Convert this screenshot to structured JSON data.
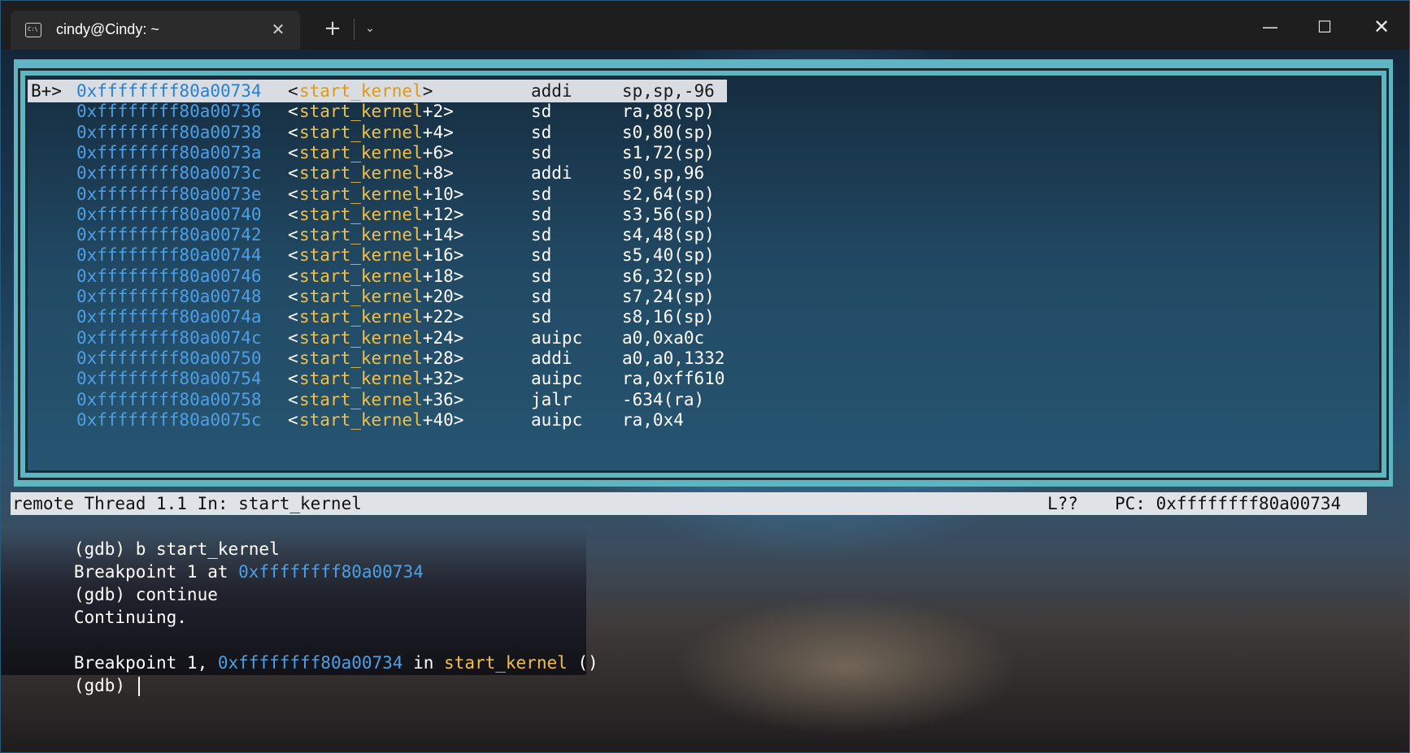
{
  "tab": {
    "title": "cindy@Cindy: ~",
    "icon_glyph": "C:\\",
    "close_glyph": "✕",
    "new_tab_glyph": "+",
    "dropdown_glyph": "⌄"
  },
  "window_controls": {
    "minimize": "—",
    "maximize": "☐",
    "close": "✕"
  },
  "colors": {
    "address": "#4f9fe6",
    "symbol": "#f0c04a",
    "tui_border": "#5fb6c2",
    "status_bg": "#dfe3e8"
  },
  "disassembly": [
    {
      "marker": "B+>",
      "addr": "0xffffffff80a00734",
      "sym": "start_kernel",
      "off": ">",
      "op": "addi",
      "args": "sp,sp,-96",
      "current": true
    },
    {
      "marker": "",
      "addr": "0xffffffff80a00736",
      "sym": "start_kernel",
      "off": "+2>",
      "op": "sd",
      "args": "ra,88(sp)"
    },
    {
      "marker": "",
      "addr": "0xffffffff80a00738",
      "sym": "start_kernel",
      "off": "+4>",
      "op": "sd",
      "args": "s0,80(sp)"
    },
    {
      "marker": "",
      "addr": "0xffffffff80a0073a",
      "sym": "start_kernel",
      "off": "+6>",
      "op": "sd",
      "args": "s1,72(sp)"
    },
    {
      "marker": "",
      "addr": "0xffffffff80a0073c",
      "sym": "start_kernel",
      "off": "+8>",
      "op": "addi",
      "args": "s0,sp,96"
    },
    {
      "marker": "",
      "addr": "0xffffffff80a0073e",
      "sym": "start_kernel",
      "off": "+10>",
      "op": "sd",
      "args": "s2,64(sp)"
    },
    {
      "marker": "",
      "addr": "0xffffffff80a00740",
      "sym": "start_kernel",
      "off": "+12>",
      "op": "sd",
      "args": "s3,56(sp)"
    },
    {
      "marker": "",
      "addr": "0xffffffff80a00742",
      "sym": "start_kernel",
      "off": "+14>",
      "op": "sd",
      "args": "s4,48(sp)"
    },
    {
      "marker": "",
      "addr": "0xffffffff80a00744",
      "sym": "start_kernel",
      "off": "+16>",
      "op": "sd",
      "args": "s5,40(sp)"
    },
    {
      "marker": "",
      "addr": "0xffffffff80a00746",
      "sym": "start_kernel",
      "off": "+18>",
      "op": "sd",
      "args": "s6,32(sp)"
    },
    {
      "marker": "",
      "addr": "0xffffffff80a00748",
      "sym": "start_kernel",
      "off": "+20>",
      "op": "sd",
      "args": "s7,24(sp)"
    },
    {
      "marker": "",
      "addr": "0xffffffff80a0074a",
      "sym": "start_kernel",
      "off": "+22>",
      "op": "sd",
      "args": "s8,16(sp)"
    },
    {
      "marker": "",
      "addr": "0xffffffff80a0074c",
      "sym": "start_kernel",
      "off": "+24>",
      "op": "auipc",
      "args": "a0,0xa0c"
    },
    {
      "marker": "",
      "addr": "0xffffffff80a00750",
      "sym": "start_kernel",
      "off": "+28>",
      "op": "addi",
      "args": "a0,a0,1332"
    },
    {
      "marker": "",
      "addr": "0xffffffff80a00754",
      "sym": "start_kernel",
      "off": "+32>",
      "op": "auipc",
      "args": "ra,0xff610"
    },
    {
      "marker": "",
      "addr": "0xffffffff80a00758",
      "sym": "start_kernel",
      "off": "+36>",
      "op": "jalr",
      "args": "-634(ra)"
    },
    {
      "marker": "",
      "addr": "0xffffffff80a0075c",
      "sym": "start_kernel",
      "off": "+40>",
      "op": "auipc",
      "args": "ra,0x4"
    }
  ],
  "status": {
    "left": "remote Thread 1.1 In: start_kernel",
    "line": "L??",
    "pc": "PC: 0xffffffff80a00734"
  },
  "console": {
    "line1": "(gdb) b start_kernel",
    "line2_prefix": "Breakpoint 1 at ",
    "line2_addr": "0xffffffff80a00734",
    "line3": "(gdb) continue",
    "line4": "Continuing.",
    "line6_prefix": "Breakpoint 1, ",
    "line6_addr": "0xffffffff80a00734",
    "line6_mid": " in ",
    "line6_sym": "start_kernel",
    "line6_suffix": " ()",
    "prompt": "(gdb) "
  }
}
